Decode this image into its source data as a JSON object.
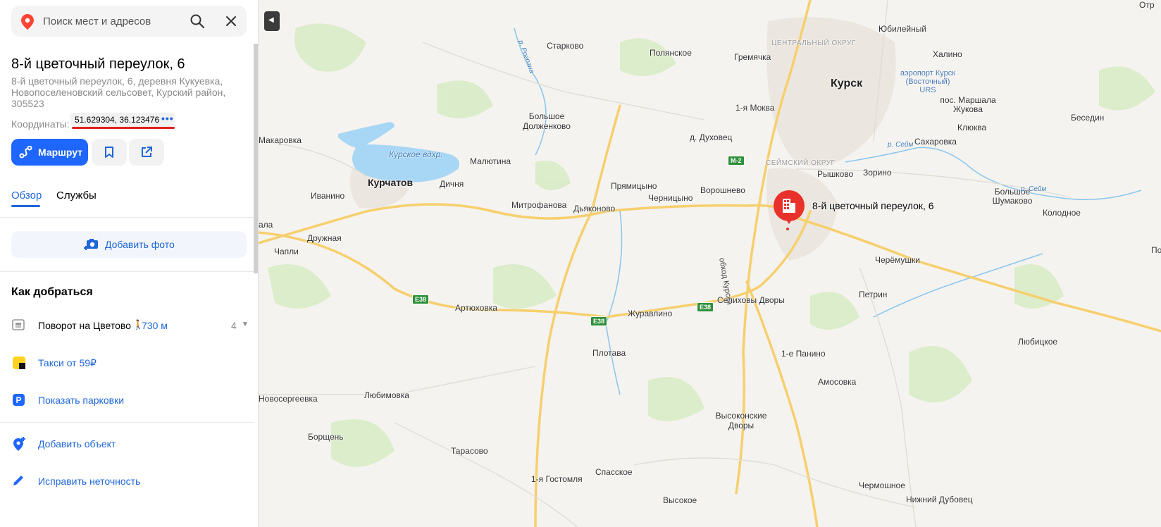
{
  "search": {
    "placeholder": "Поиск мест и адресов"
  },
  "place": {
    "title": "8-й цветочный переулок, 6",
    "address": "8-й цветочный переулок, 6, деревня Кукуевка, Новопоселеновский сельсовет, Курский район, 305523",
    "coords_label": "Координаты:",
    "coords_value": "51.629304, 36.123476",
    "coords_more": "•••"
  },
  "actions": {
    "route_label": "Маршрут"
  },
  "tabs": [
    {
      "label": "Обзор",
      "active": true
    },
    {
      "label": "Службы",
      "active": false
    }
  ],
  "add_photo_label": "Добавить фото",
  "directions": {
    "title": "Как добраться",
    "stop_name": "Поворот на Цветово",
    "stop_distance": "730 м",
    "stop_count": "4",
    "taxi_label": "Такси от 59₽",
    "parking_label": "Показать парковки"
  },
  "footer": {
    "add_object": "Добавить объект",
    "fix_error": "Исправить неточность"
  },
  "map": {
    "marker_label": "8-й цветочный переулок, 6",
    "road_badges": [
      "E38",
      "E38",
      "E38",
      "M-2"
    ],
    "labels": {
      "kursk": "Курск",
      "kurchatov": "Курчатов",
      "reservoir": "Курское вдхр.",
      "central_district": "ЦЕНТРАЛЬНЫЙ ОКРУГ",
      "seim_district": "СЕЙМСКИЙ ОКРУГ",
      "airport": "аэропорт Курск (Восточный) URS",
      "starkovo": "Старково",
      "polyanskoe": "Полянское",
      "gremyachka": "Гремячка",
      "yubileyny": "Юбилейный",
      "khalino": "Халино",
      "rozhna": "р. Рогозна",
      "bolshoe_dolzhenkovo": "Большое Долженково",
      "makarovka": "Макаровка",
      "malyutina": "Малютина",
      "mokva1": "1-я Моква",
      "dukhovets": "д. Духовец",
      "pos_marshala": "пос. Маршала Жукова",
      "klyukva": "Клюква",
      "sakharovka": "Сахаровка",
      "seym1": "р. Сейм",
      "beseding": "Беседин",
      "rysh": "Рышково",
      "zorino": "Зорино",
      "ivanino": "Иванино",
      "dichnya": "Дичня",
      "pryamitsyno": "Прямицыно",
      "voroshnevo": "Ворошнево",
      "chernitsyno": "Черницыно",
      "mitrofanova": "Митрофанова",
      "dyakonovo": "Дьяконово",
      "bolshoe_shumakovo": "Большое Шумаково",
      "kolodnoe": "Колодное",
      "seym2": "р. Сейм",
      "druzhnaya": "Дружная",
      "chapli": "Чапли",
      "ala": "ала",
      "obkhod": "обход Курска",
      "cheremushki": "Черёмушки",
      "petrin": "Петрин",
      "artyukhovka": "Артюховка",
      "zhuravlino": "Журавлино",
      "selikhovy": "Селиховы Дворы",
      "plotava": "Плотава",
      "panino1": "1-е Панино",
      "lyubitskoe": "Любицкое",
      "amosovka": "Амосовка",
      "novosergeevka": "Новосергеевка",
      "lyubimovka": "Любимовка",
      "vysokonskie": "Высоконские Дворы",
      "borshchen": "Борщень",
      "tarasovo": "Тарасово",
      "spasskoe": "Спасское",
      "gostomlya": "1-я Гостомля",
      "chermoshnoe": "Чермошное",
      "nizhny_dubovets": "Нижний Дубовец",
      "vysokoe": "Высокое",
      "otr": "Отр",
      "po": "По"
    }
  }
}
